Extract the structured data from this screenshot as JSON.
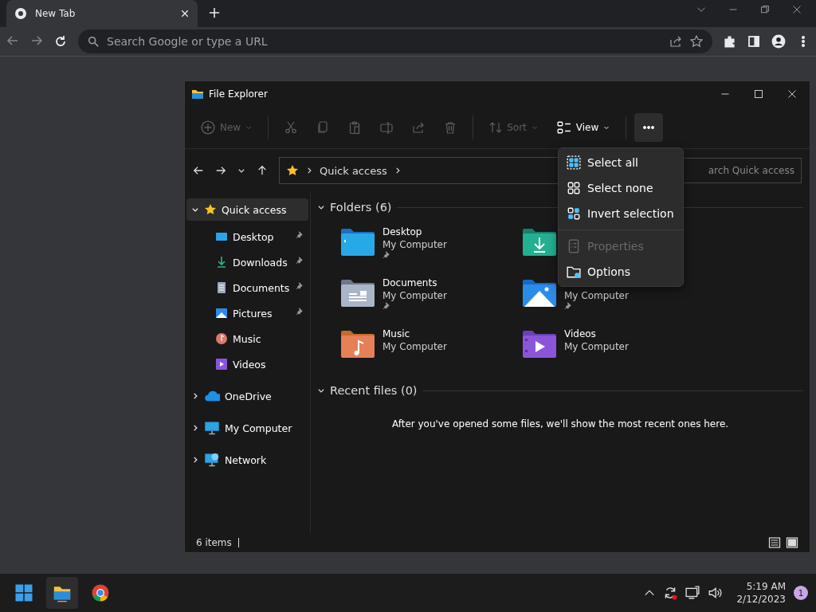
{
  "browser": {
    "tab": {
      "title": "New Tab"
    },
    "address": {
      "placeholder": "Search Google or type a URL"
    }
  },
  "explorer": {
    "title": "File Explorer",
    "commands": [
      {
        "kind": "new",
        "label": "New",
        "disabled": true
      },
      {
        "kind": "cut",
        "disabled": true
      },
      {
        "kind": "copy",
        "disabled": true
      },
      {
        "kind": "paste",
        "disabled": true
      },
      {
        "kind": "rename",
        "disabled": true
      },
      {
        "kind": "share",
        "disabled": true
      },
      {
        "kind": "delete",
        "disabled": true
      },
      {
        "kind": "sort",
        "label": "Sort",
        "disabled": true
      },
      {
        "kind": "view",
        "label": "View",
        "disabled": false
      },
      {
        "kind": "more",
        "disabled": false
      }
    ],
    "breadcrumb": "Quick access",
    "search": {
      "placeholder": "arch Quick access"
    },
    "sidebar": [
      {
        "kind": "quick",
        "label": "Quick access",
        "expanded": true,
        "selected": true,
        "children": [
          {
            "kind": "desktop",
            "label": "Desktop",
            "pinned": true
          },
          {
            "kind": "downloads",
            "label": "Downloads",
            "pinned": true
          },
          {
            "kind": "documents",
            "label": "Documents",
            "pinned": true
          },
          {
            "kind": "pictures",
            "label": "Pictures",
            "pinned": true
          },
          {
            "kind": "music",
            "label": "Music",
            "pinned": false
          },
          {
            "kind": "videos",
            "label": "Videos",
            "pinned": false
          }
        ]
      },
      {
        "kind": "onedrive",
        "label": "OneDrive",
        "expanded": false,
        "selected": false
      },
      {
        "kind": "computer",
        "label": "My Computer",
        "expanded": false,
        "selected": false
      },
      {
        "kind": "network",
        "label": "Network",
        "expanded": false,
        "selected": false
      }
    ],
    "folders": {
      "title": "Folders (6)",
      "items": [
        {
          "kind": "desktop",
          "name": "Desktop",
          "location": "My Computer",
          "pinned": true
        },
        {
          "kind": "downloads"
        },
        {
          "kind": "documents",
          "name": "Documents",
          "location": "My Computer",
          "pinned": true
        },
        {
          "kind": "pictures",
          "location": "My Computer",
          "pinned": true
        },
        {
          "kind": "music",
          "name": "Music",
          "location": "My Computer",
          "pinned": false
        },
        {
          "kind": "videos",
          "name": "Videos",
          "location": "My Computer",
          "pinned": false
        }
      ]
    },
    "recent": {
      "title": "Recent files (0)",
      "message": "After you've opened some files, we'll show the most recent ones here."
    },
    "status": "6 items",
    "menu": [
      {
        "kind": "selectall",
        "label": "Select all",
        "disabled": false
      },
      {
        "kind": "selectnone",
        "label": "Select none",
        "disabled": false
      },
      {
        "kind": "invert",
        "label": "Invert selection",
        "disabled": false
      },
      {
        "kind": "properties",
        "label": "Properties",
        "disabled": true
      },
      {
        "kind": "options",
        "label": "Options",
        "disabled": false
      }
    ]
  },
  "taskbar": {
    "time": "5:19 AM",
    "date": "2/12/2023",
    "notifications": "1"
  }
}
